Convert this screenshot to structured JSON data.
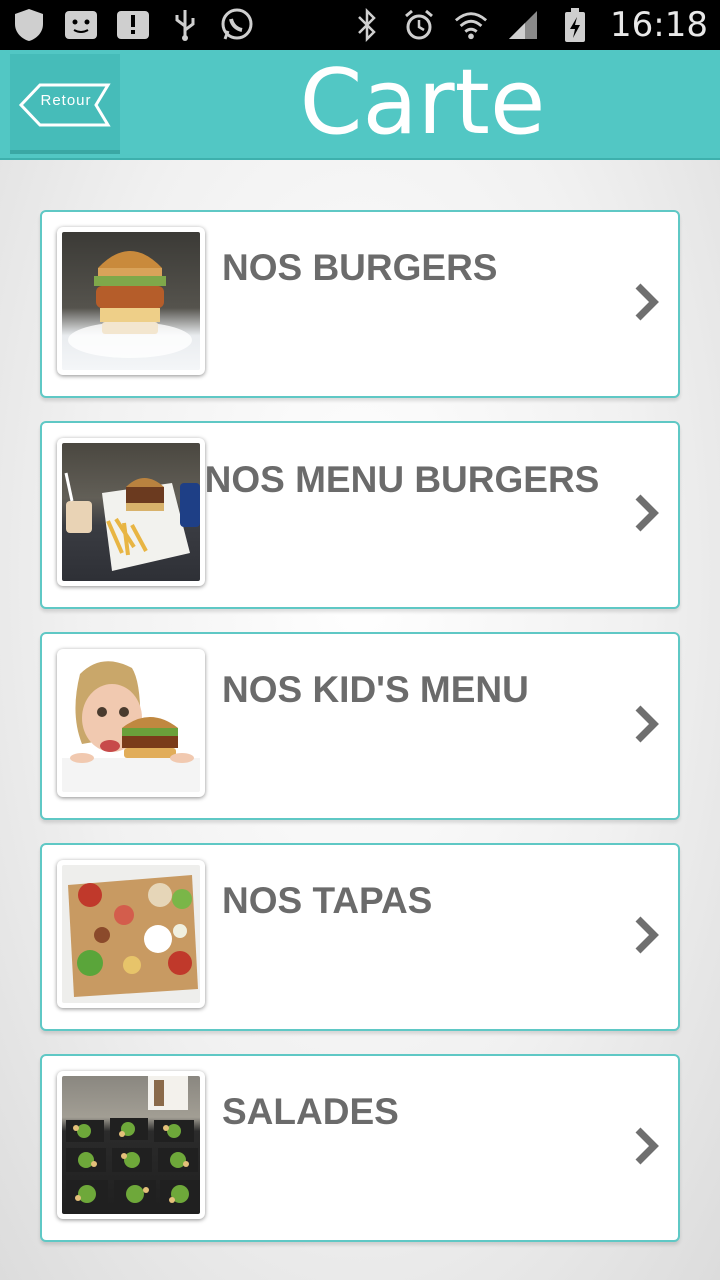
{
  "status_bar": {
    "time": "16:18",
    "left_icons": [
      "shield-icon",
      "screenshot-icon",
      "alert-icon",
      "usb-icon",
      "whatsapp-icon"
    ],
    "right_icons": [
      "bluetooth-icon",
      "alarm-icon",
      "wifi-icon",
      "signal-icon",
      "battery-icon"
    ]
  },
  "header": {
    "back_label": "Retour",
    "title": "Carte",
    "color": "#52c7c4"
  },
  "menu": {
    "items": [
      {
        "label": "NOS BURGERS",
        "image": "burger-photo"
      },
      {
        "label": "NOS MENU BURGERS",
        "image": "menu-burger-photo"
      },
      {
        "label": "NOS KID'S MENU",
        "image": "kids-menu-photo"
      },
      {
        "label": "NOS TAPAS",
        "image": "tapas-photo"
      },
      {
        "label": "SALADES",
        "image": "salads-photo"
      }
    ]
  },
  "colors": {
    "accent": "#52c7c4",
    "item_border": "#5fc8c5",
    "label": "#6b6b6b"
  }
}
